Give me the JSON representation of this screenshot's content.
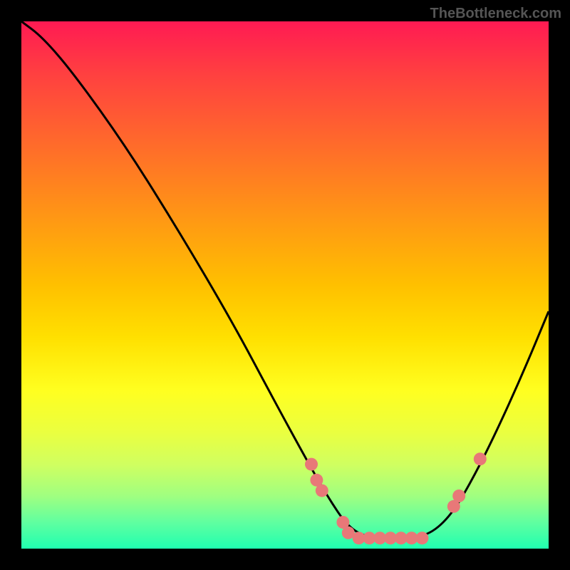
{
  "watermark": "TheBottleneck.com",
  "chart_data": {
    "type": "line",
    "title": "",
    "xlabel": "",
    "ylabel": "",
    "xlim": [
      0,
      100
    ],
    "ylim": [
      0,
      100
    ],
    "curve": {
      "description": "V-shaped bottleneck curve descending from top-left to a flat valley near x=62-78 then rising to right edge",
      "points": [
        {
          "x": 0,
          "y": 100
        },
        {
          "x": 4,
          "y": 97
        },
        {
          "x": 10,
          "y": 90
        },
        {
          "x": 20,
          "y": 76
        },
        {
          "x": 30,
          "y": 60
        },
        {
          "x": 40,
          "y": 43
        },
        {
          "x": 48,
          "y": 28
        },
        {
          "x": 54,
          "y": 17
        },
        {
          "x": 58,
          "y": 10
        },
        {
          "x": 62,
          "y": 4
        },
        {
          "x": 66,
          "y": 2
        },
        {
          "x": 70,
          "y": 2
        },
        {
          "x": 74,
          "y": 2
        },
        {
          "x": 78,
          "y": 3
        },
        {
          "x": 82,
          "y": 7
        },
        {
          "x": 86,
          "y": 14
        },
        {
          "x": 90,
          "y": 22
        },
        {
          "x": 95,
          "y": 33
        },
        {
          "x": 100,
          "y": 45
        }
      ]
    },
    "data_points": [
      {
        "x": 55,
        "y": 16
      },
      {
        "x": 56,
        "y": 13
      },
      {
        "x": 57,
        "y": 11
      },
      {
        "x": 61,
        "y": 5
      },
      {
        "x": 62,
        "y": 3
      },
      {
        "x": 64,
        "y": 2
      },
      {
        "x": 66,
        "y": 2
      },
      {
        "x": 68,
        "y": 2
      },
      {
        "x": 70,
        "y": 2
      },
      {
        "x": 72,
        "y": 2
      },
      {
        "x": 74,
        "y": 2
      },
      {
        "x": 76,
        "y": 2
      },
      {
        "x": 82,
        "y": 8
      },
      {
        "x": 83,
        "y": 10
      },
      {
        "x": 87,
        "y": 17
      }
    ],
    "gradient_colors": {
      "top": "#ff1a53",
      "mid_top": "#ff8020",
      "mid": "#ffe000",
      "mid_bot": "#d0ff60",
      "bottom": "#20ffb0"
    }
  }
}
